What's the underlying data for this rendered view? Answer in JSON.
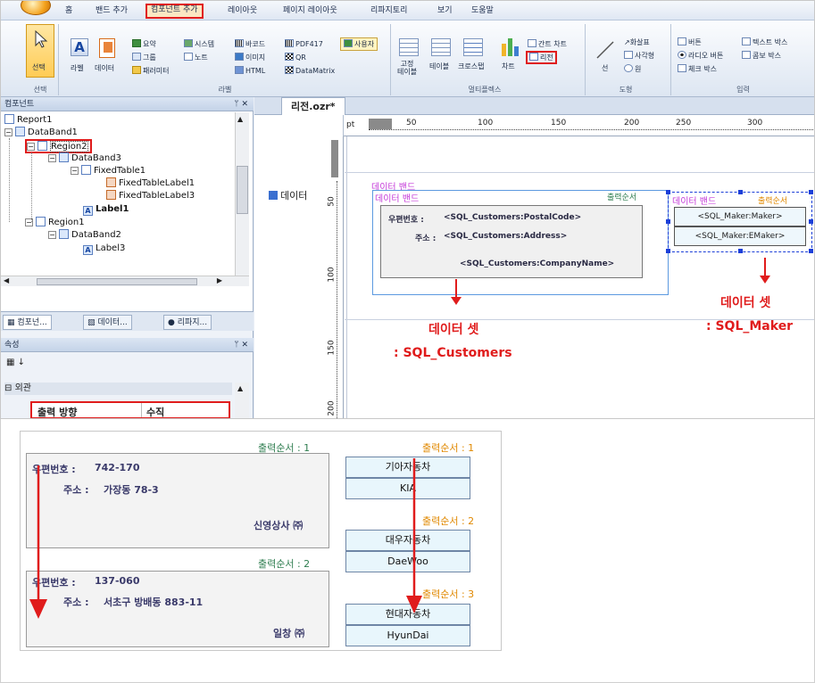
{
  "menu": {
    "items": [
      "홈",
      "밴드 추가",
      "컴포넌트 추가",
      "레이아웃",
      "페이지 레이아웃",
      "리파지토리",
      "보기",
      "도움말"
    ]
  },
  "ribbon": {
    "select": "선택",
    "label": "라벨",
    "data": "데이터",
    "summary": "요약",
    "group": "그룹",
    "parameter": "패러미터",
    "system": "시스템",
    "note": "노트",
    "image": "이미지",
    "html": "HTML",
    "barcode": "바코드",
    "pdf417": "PDF417",
    "qr": "QR",
    "datamatrix": "DataMatrix",
    "user": "사용자",
    "fixed_table": "고정\n테이블",
    "table": "테이블",
    "crosstab": "크로스탭",
    "chart": "차트",
    "gantt": "간트 차트",
    "region": "리전",
    "line": "선",
    "arrow": "화살표",
    "rect": "사각형",
    "circle": "원",
    "button": "버튼",
    "radio": "라디오 버튼",
    "checkbox": "체크 박스",
    "textbox": "텍스트 박스",
    "combobox": "콤보 박스",
    "groups": {
      "select": "선택",
      "label": "라벨",
      "multi": "멀티플렉스",
      "shape": "도형",
      "input": "입력"
    }
  },
  "components_panel": {
    "title": "컴포넌트",
    "pin": "ᛘ ✕",
    "tree": [
      {
        "label": "Report1",
        "level": 0
      },
      {
        "label": "DataBand1",
        "level": 0
      },
      {
        "label": "Region2",
        "level": 1
      },
      {
        "label": "DataBand3",
        "level": 2
      },
      {
        "label": "FixedTable1",
        "level": 3
      },
      {
        "label": "FixedTableLabel1",
        "level": 4
      },
      {
        "label": "FixedTableLabel3",
        "level": 4
      },
      {
        "label": "Label1",
        "level": 3
      },
      {
        "label": "Region1",
        "level": 1
      },
      {
        "label": "DataBand2",
        "level": 2
      },
      {
        "label": "Label3",
        "level": 3
      }
    ],
    "tabs": [
      "컴포넌...",
      "데이터...",
      "리파지..."
    ]
  },
  "properties_panel": {
    "title": "속성",
    "category": "외관",
    "prop_name": "출력 방향",
    "prop_value": "수직"
  },
  "designer": {
    "doc_tab": "리전.ozr*",
    "unit": "pt",
    "ruler_h": [
      "50",
      "100",
      "150",
      "200",
      "250",
      "300"
    ],
    "ruler_v": [
      "50",
      "100",
      "150",
      "200"
    ],
    "band_name": "데이터",
    "outer_band": "데이터 밴드",
    "inner_band": "데이터 밴드",
    "order_label": "출력순서",
    "postal_label": "우편번호 :",
    "postal_field": "<SQL_Customers:PostalCode>",
    "address_label": "주소 :",
    "address_field": "<SQL_Customers:Address>",
    "company_field": "<SQL_Customers:CompanyName>",
    "right_band": "데이터 밴드",
    "right_order": "출력순서",
    "maker_field": "<SQL_Maker:Maker>",
    "emaker_field": "<SQL_Maker:EMaker>"
  },
  "annotations": {
    "dataset_title": "데이터 셋",
    "dataset_customers": ": SQL_Customers",
    "dataset_maker_title": "데이터 셋",
    "dataset_maker": ": SQL_Maker"
  },
  "preview": {
    "customers": [
      {
        "order": "출력순서 : 1",
        "postal_label": "우편번호 :",
        "postal": "742-170",
        "address_label": "주소 :",
        "address": "가장동 78-3",
        "company": "신영상사 ㈜"
      },
      {
        "order": "출력순서 : 2",
        "postal_label": "우편번호 :",
        "postal": "137-060",
        "address_label": "주소 :",
        "address": "서초구 방배동 883-11",
        "company": "일창 ㈜"
      }
    ],
    "makers": [
      {
        "order": "출력순서 : 1",
        "name": "기아자동차",
        "ename": "KIA"
      },
      {
        "order": "출력순서 : 2",
        "name": "대우자동차",
        "ename": "DaeWoo"
      },
      {
        "order": "출력순서 : 3",
        "name": "현대자동차",
        "ename": "HyunDai"
      }
    ]
  }
}
